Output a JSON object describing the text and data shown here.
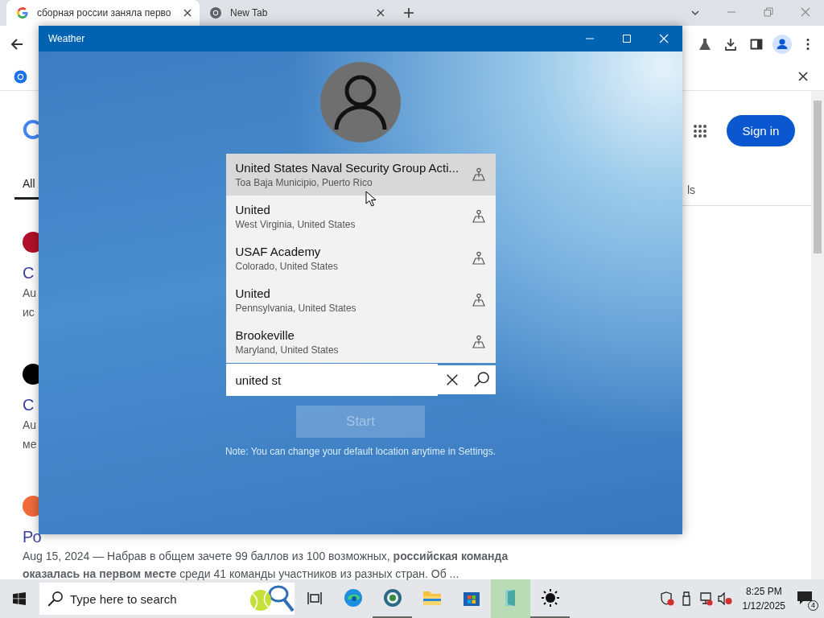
{
  "browser": {
    "tabs": [
      {
        "kind": "google",
        "title": "сборная россии заняла перво",
        "selected": true
      },
      {
        "kind": "chrome",
        "title": "New Tab",
        "selected": false
      }
    ]
  },
  "page": {
    "nav_tabs": [
      {
        "label": "All",
        "selected": true
      },
      {
        "label": "ls",
        "selected": false
      }
    ],
    "sign_in": "Sign in",
    "results": [
      {
        "color": "#b0102a",
        "title": "С",
        "lines": [
          "Au",
          "ис"
        ]
      },
      {
        "color": "#000000",
        "title": "С",
        "lines": [
          "Au",
          "ме"
        ]
      },
      {
        "color": "#ef6b3a",
        "title": "Ро"
      }
    ],
    "snippet": "Aug 15, 2024 — Набрав в общем зачете 99 баллов из 100 возможных, **российская команда оказалась на первом месте** среди 41 команды участников из разных стран. Об ..."
  },
  "weather": {
    "title": "Weather",
    "suggestions": [
      {
        "name": "United States Naval Security Group Acti...",
        "place": "Toa Baja Municipio, Puerto Rico",
        "highlighted": true
      },
      {
        "name": "United",
        "place": "West Virginia, United States",
        "highlighted": false
      },
      {
        "name": "USAF Academy",
        "place": "Colorado, United States",
        "highlighted": false
      },
      {
        "name": "United",
        "place": "Pennsylvania, United States",
        "highlighted": false
      },
      {
        "name": "Brookeville",
        "place": "Maryland, United States",
        "highlighted": false
      }
    ],
    "search": {
      "value": "united st"
    },
    "start": {
      "label": "Start",
      "disabled": true
    },
    "note": "Note: You can change your default location anytime in Settings."
  },
  "taskbar": {
    "search": {
      "placeholder": "Type here to search"
    },
    "apps": [
      {
        "kind": "edge",
        "running": false,
        "selected": false
      },
      {
        "kind": "globe",
        "running": true,
        "selected": false
      },
      {
        "kind": "folder",
        "running": false,
        "selected": false
      },
      {
        "kind": "store",
        "running": false,
        "selected": false
      },
      {
        "kind": "book",
        "running": false,
        "selected": true
      },
      {
        "kind": "sun",
        "running": true,
        "selected": false
      }
    ],
    "clock": {
      "time": "8:25 PM",
      "date": "1/12/2025"
    },
    "notifications": "4"
  }
}
